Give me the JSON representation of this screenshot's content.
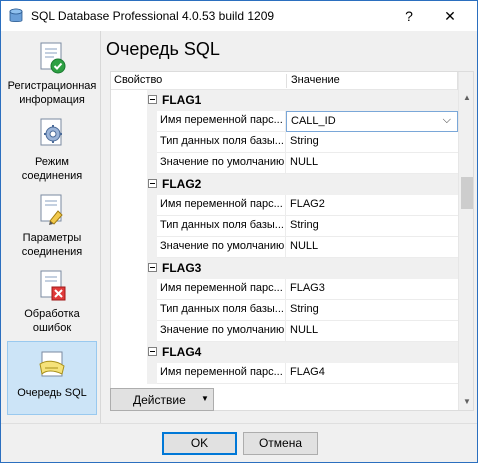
{
  "window": {
    "title": "SQL Database Professional 4.0.53 build 1209",
    "help_label": "?",
    "close_label": "✕"
  },
  "sidebar": {
    "items": [
      {
        "label": "Регистрационная информация",
        "icon": "registration-icon"
      },
      {
        "label": "Режим соединения",
        "icon": "connection-mode-icon"
      },
      {
        "label": "Параметры соединения",
        "icon": "connection-params-icon"
      },
      {
        "label": "Обработка ошибок",
        "icon": "error-handling-icon"
      },
      {
        "label": "Очередь SQL",
        "icon": "sql-queue-icon",
        "active": true
      }
    ]
  },
  "main": {
    "title": "Очередь SQL",
    "grid": {
      "col_property": "Свойство",
      "col_value": "Значение",
      "groups": [
        {
          "name": "FLAG1",
          "rows": [
            {
              "name": "Имя переменной парс...",
              "value": "CALL_ID"
            },
            {
              "name": "Тип данных поля базы...",
              "value": "String"
            },
            {
              "name": "Значение по умолчанию",
              "value": "NULL"
            }
          ]
        },
        {
          "name": "FLAG2",
          "rows": [
            {
              "name": "Имя переменной парс...",
              "value": "FLAG2"
            },
            {
              "name": "Тип данных поля базы...",
              "value": "String"
            },
            {
              "name": "Значение по умолчанию",
              "value": "NULL"
            }
          ]
        },
        {
          "name": "FLAG3",
          "rows": [
            {
              "name": "Имя переменной парс...",
              "value": "FLAG3"
            },
            {
              "name": "Тип данных поля базы...",
              "value": "String"
            },
            {
              "name": "Значение по умолчанию",
              "value": "NULL"
            }
          ]
        },
        {
          "name": "FLAG4",
          "rows": [
            {
              "name": "Имя переменной парс...",
              "value": "FLAG4"
            }
          ]
        }
      ]
    },
    "action_button": "Действие"
  },
  "footer": {
    "ok": "OK",
    "cancel": "Отмена"
  },
  "colors": {
    "selected_nav": "#cce4f7",
    "window_border": "#2b6fbf",
    "ok_border": "#0078d7"
  }
}
